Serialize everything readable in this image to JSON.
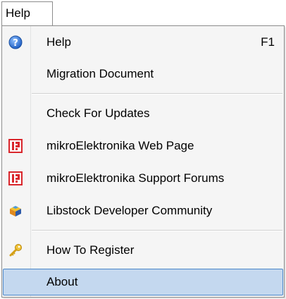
{
  "menubar": {
    "help_label": "Help"
  },
  "menu": {
    "items": [
      {
        "label": "Help",
        "shortcut": "F1",
        "icon": "help-question-icon"
      },
      {
        "label": "Migration Document"
      },
      {
        "label": "Check For Updates"
      },
      {
        "label": "mikroElektronika Web Page",
        "icon": "mikroe-logo-icon"
      },
      {
        "label": "mikroElektronika Support Forums",
        "icon": "mikroe-logo-icon"
      },
      {
        "label": "Libstock Developer Community",
        "icon": "libstock-icon"
      },
      {
        "label": "How To Register",
        "icon": "key-icon"
      },
      {
        "label": "About",
        "highlighted": true
      }
    ]
  },
  "colors": {
    "highlight_background": "#c4d8ef",
    "highlight_border": "#4a86c8",
    "help_icon_blue": "#2f6fd0",
    "mikroe_red": "#d9262c",
    "key_gold": "#e3b020"
  }
}
